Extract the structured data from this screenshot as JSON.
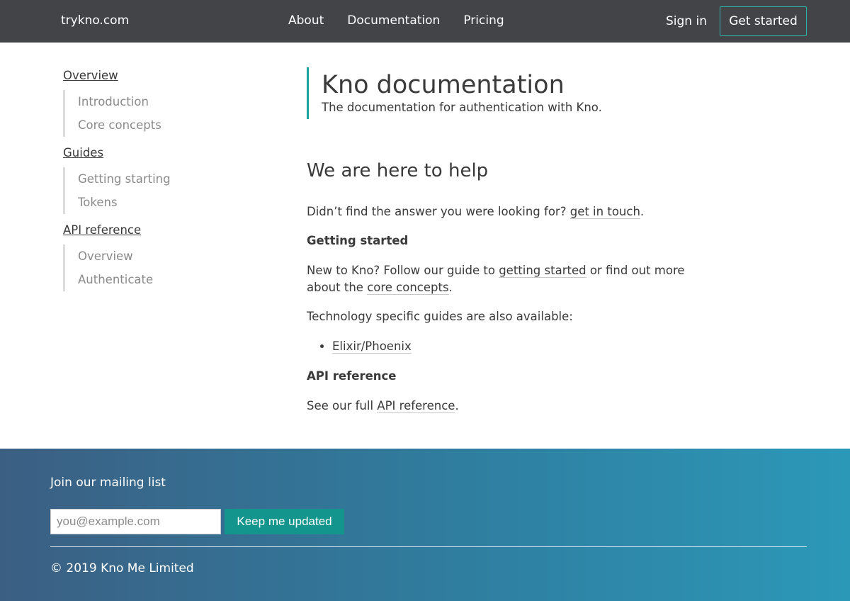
{
  "nav": {
    "brand": "trykno.com",
    "links": [
      "About",
      "Documentation",
      "Pricing"
    ],
    "sign_in": "Sign in",
    "get_started": "Get started"
  },
  "sidebar": {
    "sections": [
      {
        "title": "Overview",
        "items": [
          "Introduction",
          "Core concepts"
        ]
      },
      {
        "title": "Guides",
        "items": [
          "Getting starting",
          "Tokens"
        ]
      },
      {
        "title": "API reference",
        "items": [
          "Overview",
          "Authenticate"
        ]
      }
    ]
  },
  "content": {
    "title": "Kno documentation",
    "subtitle": "The documentation for authentication with Kno.",
    "help_heading": "We are here to help",
    "intro_before": "Didn’t find the answer you were looking for? ",
    "intro_link": "get in touch",
    "intro_after": ".",
    "getting_started_heading": "Getting started",
    "gs_text_1": "New to Kno? Follow our guide to ",
    "gs_link_1": "getting started",
    "gs_text_2": " or find out more about the ",
    "gs_link_2": "core concepts",
    "gs_text_3": ".",
    "tech_text": "Technology specific guides are also available:",
    "tech_items": [
      "Elixir/Phoenix"
    ],
    "api_heading": "API reference",
    "api_text_1": "See our full ",
    "api_link": "API reference",
    "api_text_2": "."
  },
  "footer": {
    "mailing_title": "Join our mailing list",
    "email_placeholder": "you@example.com",
    "subscribe_label": "Keep me updated",
    "copyright": "© 2019 Kno Me Limited"
  }
}
